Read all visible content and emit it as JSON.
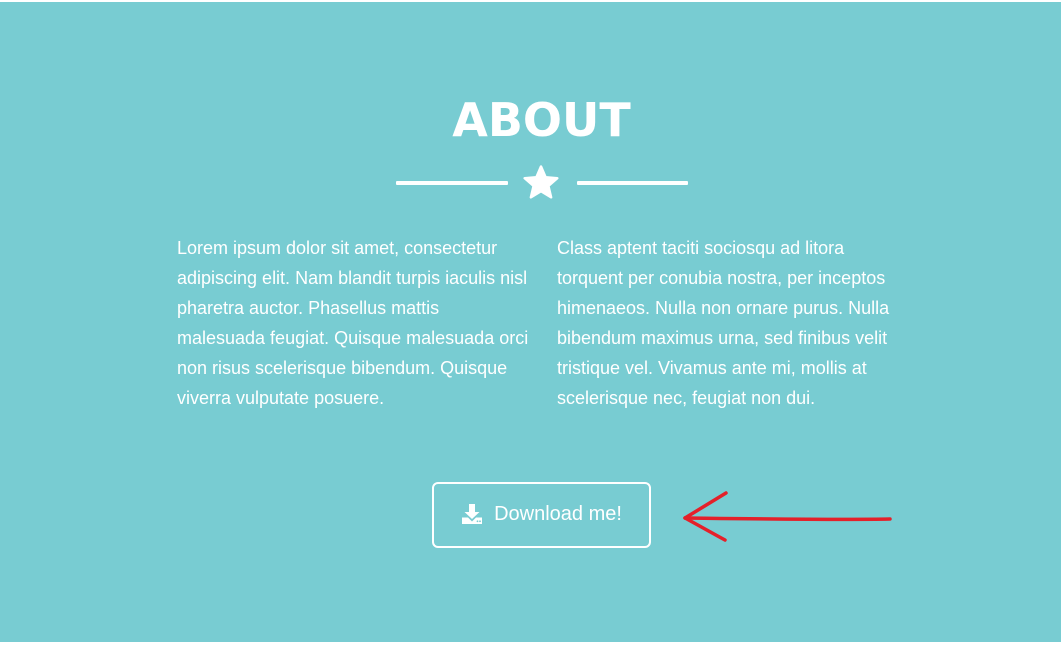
{
  "about": {
    "title": "ABOUT",
    "paragraph_left": "Lorem ipsum dolor sit amet, consectetur adipiscing elit. Nam blandit turpis iaculis nisl pharetra auctor. Phasellus mattis malesuada feugiat. Quisque malesuada orci non risus scelerisque bibendum. Quisque viverra vulputate posuere.",
    "paragraph_right": "Class aptent taciti sociosqu ad litora torquent per conubia nostra, per inceptos himenaeos. Nulla non ornare purus. Nulla bibendum maximus urna, sed finibus velit tristique vel. Vivamus ante mi, mollis at scelerisque nec, feugiat non dui.",
    "divider_icon": "star-icon",
    "download_button": {
      "label": "Download me!",
      "icon": "download-icon"
    }
  },
  "annotation": {
    "icon": "red-arrow-icon",
    "color": "#e4202a"
  },
  "colors": {
    "section_background": "#78ccd2",
    "text": "#ffffff",
    "page_background": "#ffffff"
  }
}
